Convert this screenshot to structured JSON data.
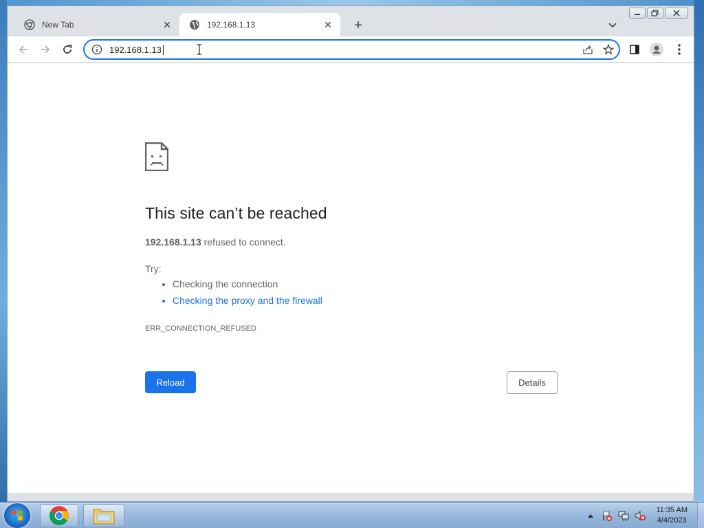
{
  "browser": {
    "tabs": [
      {
        "title": "New Tab",
        "active": false
      },
      {
        "title": "192.168.1.13",
        "active": true
      }
    ],
    "address": "192.168.1.13"
  },
  "error_page": {
    "title": "This site can’t be reached",
    "host": "192.168.1.13",
    "host_suffix": " refused to connect.",
    "try_label": "Try:",
    "suggestions": [
      "Checking the connection",
      "Checking the proxy and the firewall"
    ],
    "error_code": "ERR_CONNECTION_REFUSED",
    "reload_label": "Reload",
    "details_label": "Details"
  },
  "taskbar": {
    "time": "11:35 AM",
    "date": "4/4/2023"
  },
  "colors": {
    "accent": "#1a73e8",
    "link": "#1a73e8",
    "text_primary": "#202124",
    "text_secondary": "#5f6368"
  },
  "icons": {
    "tab_new": "chrome-logo-icon",
    "tab_active": "globe-icon",
    "page": "sad-document-icon"
  }
}
